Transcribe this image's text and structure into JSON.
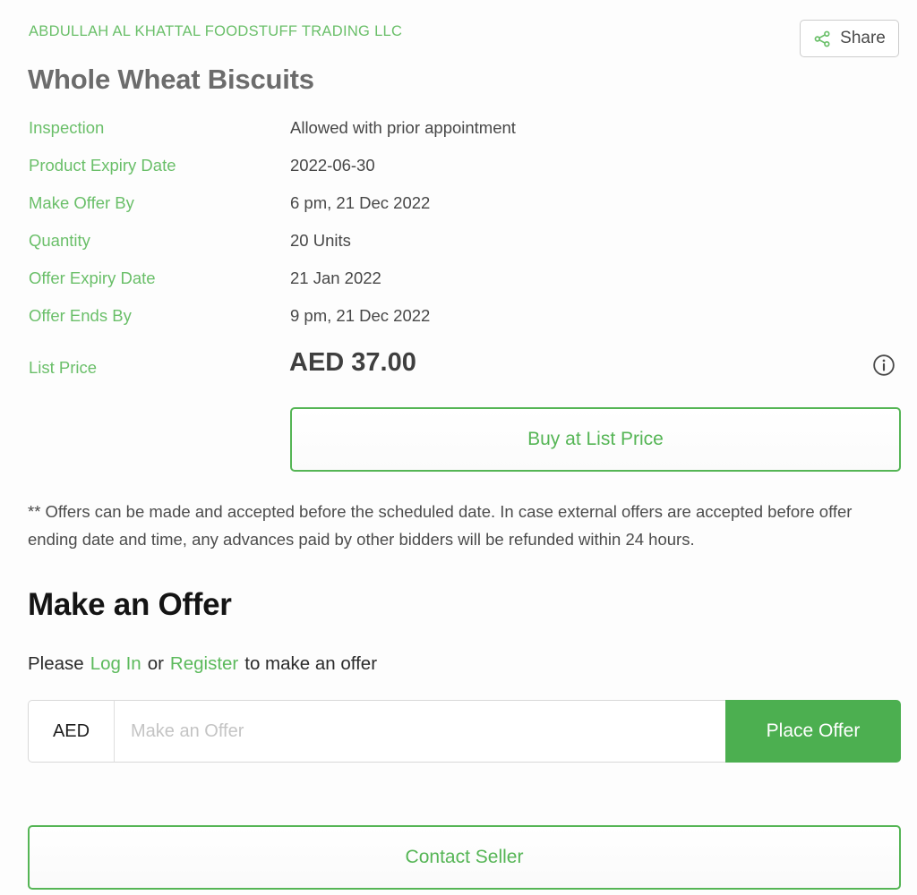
{
  "header": {
    "company_name": "ABDULLAH AL KHATTAL FOODSTUFF TRADING LLC",
    "product_title": "Whole Wheat Biscuits",
    "share_label": "Share",
    "share_icon": "share-nodes-icon"
  },
  "details": {
    "rows": [
      {
        "label": "Inspection",
        "value": "Allowed with prior appointment"
      },
      {
        "label": "Product Expiry Date",
        "value": "2022-06-30"
      },
      {
        "label": "Make Offer By",
        "value": "6 pm, 21 Dec 2022"
      },
      {
        "label": "Quantity",
        "value": "20 Units"
      },
      {
        "label": "Offer Expiry Date",
        "value": "21 Jan 2022"
      },
      {
        "label": "Offer Ends By",
        "value": "9 pm, 21 Dec 2022"
      }
    ],
    "price": {
      "label": "List Price",
      "value": "AED 37.00",
      "info_icon": "info-circle-icon"
    }
  },
  "actions": {
    "buy_label": "Buy at List Price",
    "contact_label": "Contact Seller"
  },
  "disclaimer": {
    "text": "** Offers can be made and accepted before the scheduled date. In case external offers are accepted before offer ending date and time, any advances paid by other bidders will be refunded within 24 hours."
  },
  "make_offer": {
    "heading": "Make an Offer",
    "prompt_prefix": "Please",
    "login_link": "Log In",
    "prompt_separator": "or",
    "register_link": "Register",
    "prompt_suffix": "to make an offer",
    "currency": "AED",
    "input_value": "",
    "input_placeholder": "Make an Offer",
    "place_offer_label": "Place Offer"
  },
  "colors": {
    "accent_green": "#4caf50",
    "label_green": "#6abf69",
    "border_green": "#55b555",
    "page_background": "#fdfdfd"
  }
}
